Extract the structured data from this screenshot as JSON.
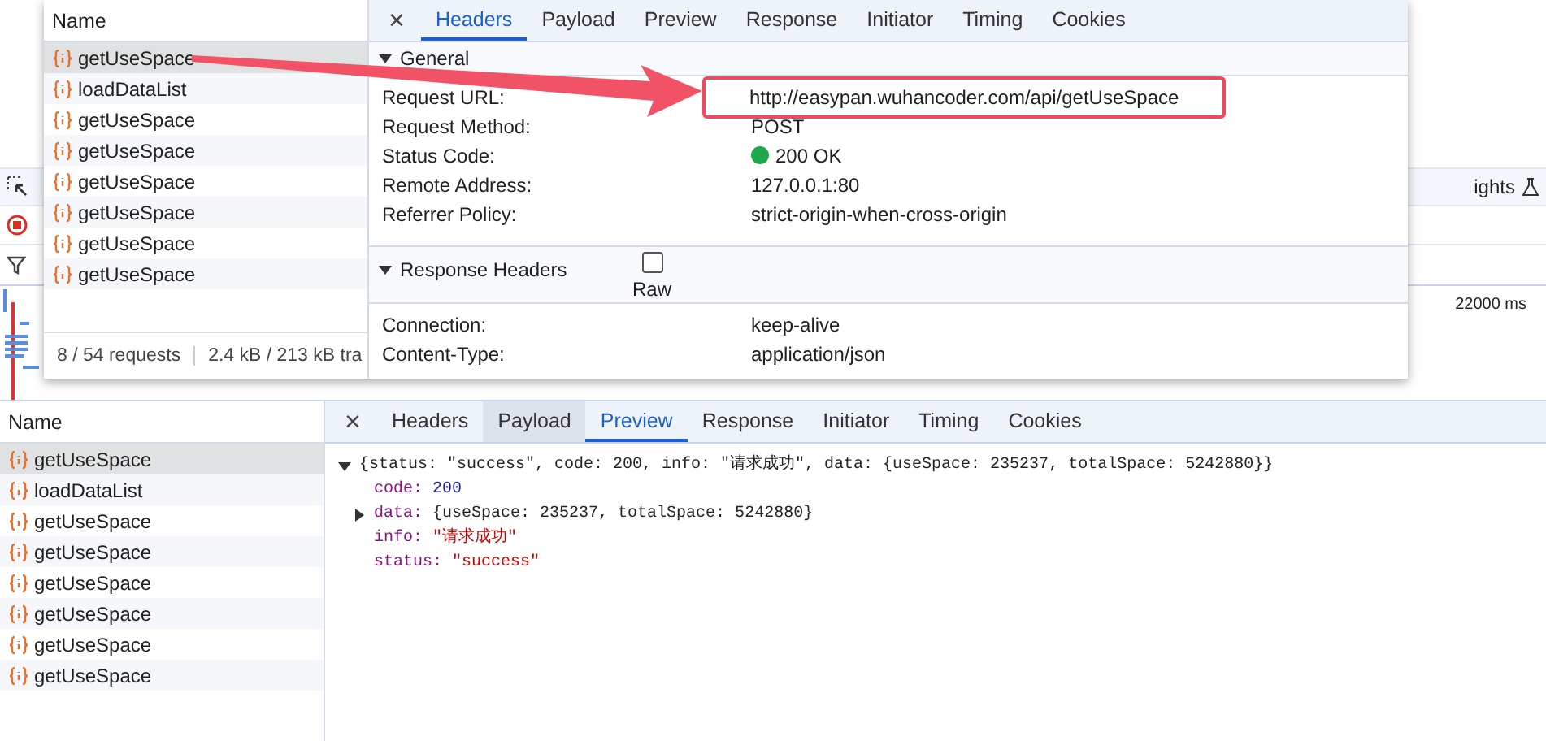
{
  "background": {
    "toolbar_text": "ights",
    "timeline_label": "22000 ms"
  },
  "popup": {
    "name_header": "Name",
    "requests": [
      {
        "name": "getUseSpace",
        "selected": true
      },
      {
        "name": "loadDataList",
        "selected": false
      },
      {
        "name": "getUseSpace",
        "selected": false
      },
      {
        "name": "getUseSpace",
        "selected": false
      },
      {
        "name": "getUseSpace",
        "selected": false
      },
      {
        "name": "getUseSpace",
        "selected": false
      },
      {
        "name": "getUseSpace",
        "selected": false
      },
      {
        "name": "getUseSpace",
        "selected": false
      }
    ],
    "summary": [
      "8 / 54 requests",
      "2.4 kB / 213 kB tra"
    ],
    "close": "×",
    "tabs": [
      {
        "label": "Headers",
        "selected": true
      },
      {
        "label": "Payload",
        "selected": false
      },
      {
        "label": "Preview",
        "selected": false
      },
      {
        "label": "Response",
        "selected": false
      },
      {
        "label": "Initiator",
        "selected": false
      },
      {
        "label": "Timing",
        "selected": false
      },
      {
        "label": "Cookies",
        "selected": false
      }
    ],
    "general": {
      "title": "General",
      "expanded": true,
      "rows": [
        {
          "label": "Request URL:",
          "value": "http://easypan.wuhancoder.com/api/getUseSpace",
          "kind": "text",
          "highlighted": true
        },
        {
          "label": "Request Method:",
          "value": "POST",
          "kind": "text",
          "highlighted": false
        },
        {
          "label": "Status Code:",
          "value": "200 OK",
          "kind": "status",
          "highlighted": false
        },
        {
          "label": "Remote Address:",
          "value": "127.0.0.1:80",
          "kind": "text",
          "highlighted": false
        },
        {
          "label": "Referrer Policy:",
          "value": "strict-origin-when-cross-origin",
          "kind": "text",
          "highlighted": false
        }
      ]
    },
    "response_headers": {
      "title": "Response Headers",
      "expanded": true,
      "raw_label": "Raw",
      "raw_checked": false,
      "rows": [
        {
          "label": "Connection:",
          "value": "keep-alive",
          "highlighted": false
        },
        {
          "label": "Content-Type:",
          "value": "application/json",
          "highlighted": false
        }
      ]
    }
  },
  "panel": {
    "name_header": "Name",
    "requests": [
      {
        "name": "getUseSpace",
        "selected": true
      },
      {
        "name": "loadDataList",
        "selected": false
      },
      {
        "name": "getUseSpace",
        "selected": false
      },
      {
        "name": "getUseSpace",
        "selected": false
      },
      {
        "name": "getUseSpace",
        "selected": false
      },
      {
        "name": "getUseSpace",
        "selected": false
      },
      {
        "name": "getUseSpace",
        "selected": false
      },
      {
        "name": "getUseSpace",
        "selected": false
      }
    ],
    "close": "×",
    "tabs": [
      {
        "label": "Headers",
        "selected": false,
        "hovered": false
      },
      {
        "label": "Payload",
        "selected": false,
        "hovered": true
      },
      {
        "label": "Preview",
        "selected": true,
        "hovered": false
      },
      {
        "label": "Response",
        "selected": false,
        "hovered": false
      },
      {
        "label": "Initiator",
        "selected": false,
        "hovered": false
      },
      {
        "label": "Timing",
        "selected": false,
        "hovered": false
      },
      {
        "label": "Cookies",
        "selected": false,
        "hovered": false
      }
    ],
    "preview": {
      "summary": "{status: \"success\", code: 200, info: \"请求成功\", data: {useSpace: 235237, totalSpace: 5242880}}",
      "expanded": true,
      "properties": [
        {
          "key": "code:",
          "value": "200",
          "kind": "number"
        },
        {
          "key": "data:",
          "value": "{useSpace: 235237, totalSpace: 5242880}",
          "kind": "object",
          "expanded": false
        },
        {
          "key": "info:",
          "value": "\"请求成功\"",
          "kind": "string"
        },
        {
          "key": "status:",
          "value": "\"success\"",
          "kind": "string"
        }
      ]
    }
  }
}
